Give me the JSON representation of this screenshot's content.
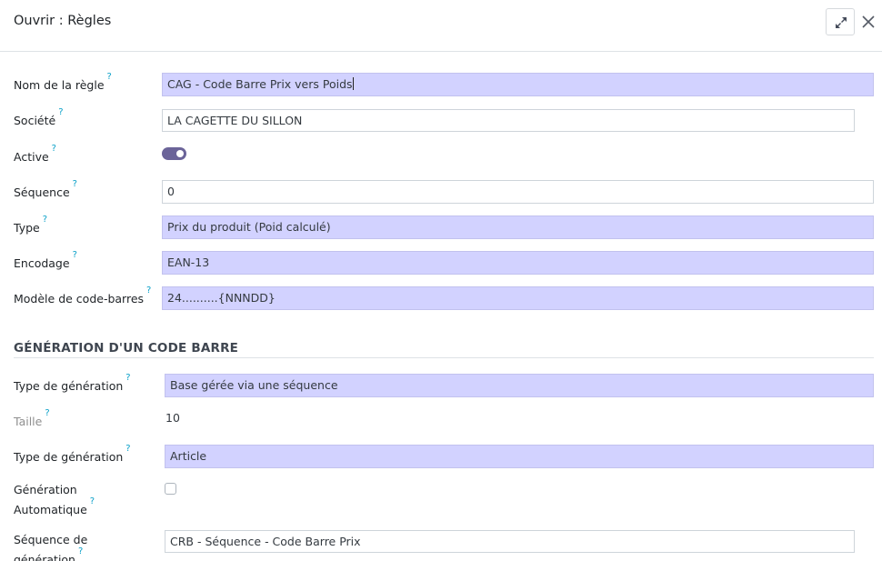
{
  "dialog": {
    "title": "Ouvrir : Règles",
    "help_mark": "?"
  },
  "fields": {
    "rule_name": {
      "label": "Nom de la règle",
      "value": "CAG - Code Barre Prix vers Poids"
    },
    "company": {
      "label": "Société",
      "value": "LA CAGETTE DU SILLON"
    },
    "active": {
      "label": "Active",
      "checked": true
    },
    "sequence": {
      "label": "Séquence",
      "value": "0"
    },
    "type": {
      "label": "Type",
      "value": "Prix du produit (Poid calculé)"
    },
    "encoding": {
      "label": "Encodage",
      "value": "EAN-13"
    },
    "barcode_pattern": {
      "label": "Modèle de code-barres",
      "value": "24..........{NNNDD}"
    }
  },
  "section": {
    "title": "GÉNÉRATION D'UN CODE BARRE",
    "generation_type_1": {
      "label": "Type de génération",
      "value": "Base gérée via une séquence"
    },
    "size": {
      "label": "Taille",
      "value": "10"
    },
    "generation_type_2": {
      "label": "Type de génération",
      "value": "Article"
    },
    "auto_generation": {
      "label_line1": "Génération",
      "label_line2": "Automatique",
      "checked": false
    },
    "generation_sequence": {
      "label_line1": "Séquence de",
      "label_line2": "génération",
      "value": "CRB - Séquence - Code Barre Prix"
    }
  },
  "colors": {
    "required_field": "#d2d2ff",
    "toggle_on": "#6b6499",
    "help_mark": "#0aa0c8"
  }
}
